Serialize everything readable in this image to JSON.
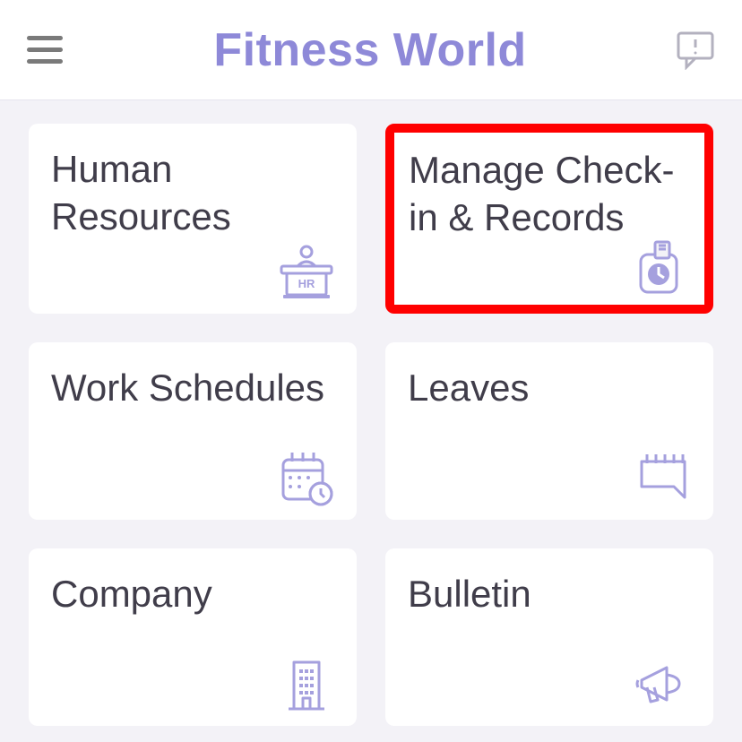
{
  "header": {
    "title": "Fitness World"
  },
  "cards": [
    {
      "label": "Human Resources",
      "icon": "hr-desk-icon",
      "highlight": false
    },
    {
      "label": "Manage Check-in & Records",
      "icon": "checkin-clock-icon",
      "highlight": true
    },
    {
      "label": "Work Schedules",
      "icon": "calendar-clock-icon",
      "highlight": false
    },
    {
      "label": "Leaves",
      "icon": "notepad-icon",
      "highlight": false
    },
    {
      "label": "Company",
      "icon": "building-icon",
      "highlight": false
    },
    {
      "label": "Bulletin",
      "icon": "megaphone-icon",
      "highlight": false
    }
  ],
  "colors": {
    "accent": "#8e89d8",
    "iconStroke": "#a5a0de",
    "highlight": "#ff0000"
  }
}
